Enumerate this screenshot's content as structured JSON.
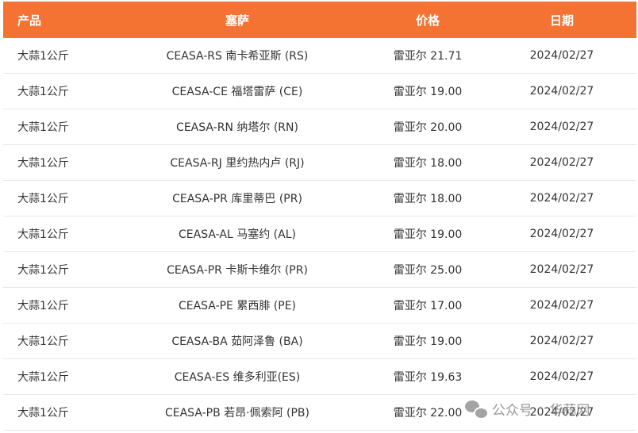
{
  "table": {
    "headers": {
      "product": "产品",
      "ceasa": "塞萨",
      "price": "价格",
      "date": "日期"
    },
    "rows": [
      {
        "product": "大蒜1公斤",
        "ceasa": "CEASA-RS 南卡希亚斯 (RS)",
        "price": "雷亚尔 21.71",
        "date": "2024/02/27"
      },
      {
        "product": "大蒜1公斤",
        "ceasa": "CEASA-CE 福塔雷萨 (CE)",
        "price": "雷亚尔 19.00",
        "date": "2024/02/27"
      },
      {
        "product": "大蒜1公斤",
        "ceasa": "CEASA-RN 纳塔尔 (RN)",
        "price": "雷亚尔 20.00",
        "date": "2024/02/27"
      },
      {
        "product": "大蒜1公斤",
        "ceasa": "CEASA-RJ 里约热内卢 (RJ)",
        "price": "雷亚尔 18.00",
        "date": "2024/02/27"
      },
      {
        "product": "大蒜1公斤",
        "ceasa": "CEASA-PR 库里蒂巴 (PR)",
        "price": "雷亚尔 18.00",
        "date": "2024/02/27"
      },
      {
        "product": "大蒜1公斤",
        "ceasa": "CEASA-AL 马塞约 (AL)",
        "price": "雷亚尔 19.00",
        "date": "2024/02/27"
      },
      {
        "product": "大蒜1公斤",
        "ceasa": "CEASA-PR 卡斯卡维尔 (PR)",
        "price": "雷亚尔 25.00",
        "date": "2024/02/27"
      },
      {
        "product": "大蒜1公斤",
        "ceasa": "CEASA-PE 累西腓 (PE)",
        "price": "雷亚尔 17.00",
        "date": "2024/02/27"
      },
      {
        "product": "大蒜1公斤",
        "ceasa": "CEASA-BA 茹阿泽鲁 (BA)",
        "price": "雷亚尔 19.00",
        "date": "2024/02/27"
      },
      {
        "product": "大蒜1公斤",
        "ceasa": "CEASA-ES 维多利亚(ES)",
        "price": "雷亚尔 19.63",
        "date": "2024/02/27"
      },
      {
        "product": "大蒜1公斤",
        "ceasa": "CEASA-PB 若昂·佩索阿 (PB)",
        "price": "雷亚尔 22.00",
        "date": "2024/02/27"
      }
    ]
  },
  "watermark": {
    "icon": "wechat-icon",
    "left_text": "公众号",
    "separator": "·",
    "right_text": "华蒜网"
  },
  "colors": {
    "header_bg": "#f47333",
    "header_text": "#ffffff",
    "row_border": "#e8e8e8"
  }
}
